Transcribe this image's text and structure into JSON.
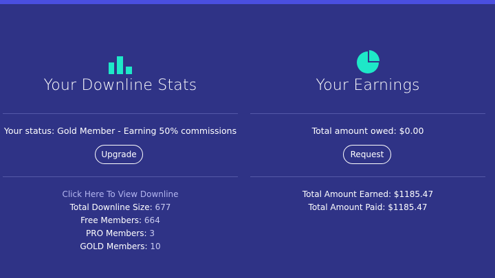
{
  "colors": {
    "background": "#2f3386",
    "top_bar": "#4a4fe0",
    "accent_icon": "#1ee8c8",
    "divider": "#5559a8",
    "link": "#b3b6f0"
  },
  "downline": {
    "icon": "bar-chart-icon",
    "title": "Your Downline Stats",
    "status_text": "Your status: Gold Member - Earning 50% commissions",
    "upgrade_label": "Upgrade",
    "view_link": "Click Here To View Downline",
    "stats": [
      {
        "label": "Total Downline Size:",
        "value": "677"
      },
      {
        "label": "Free Members:",
        "value": "664"
      },
      {
        "label": "PRO Members:",
        "value": "3"
      },
      {
        "label": "GOLD Members:",
        "value": "10"
      }
    ]
  },
  "earnings": {
    "icon": "pie-chart-icon",
    "title": "Your Earnings",
    "owed_text": "Total amount owed: $0.00",
    "request_label": "Request",
    "stats": [
      {
        "text": "Total Amount Earned: $1185.47"
      },
      {
        "text": "Total Amount Paid: $1185.47"
      }
    ]
  }
}
